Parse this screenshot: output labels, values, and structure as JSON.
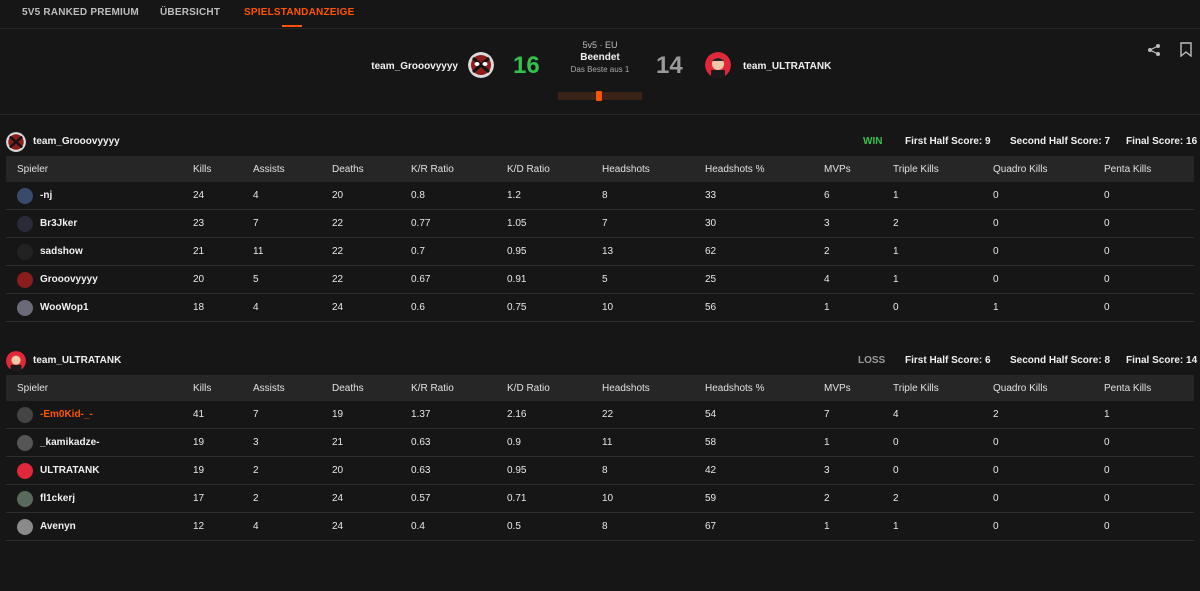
{
  "tabs": [
    {
      "label": "5V5 RANKED PREMIUM",
      "active": false
    },
    {
      "label": "ÜBERSICHT",
      "active": false
    },
    {
      "label": "SPIELSTANDANZEIGE",
      "active": true
    }
  ],
  "colors": {
    "accent": "#ff5500",
    "win": "#32c24d",
    "loss": "#9a9a9a"
  },
  "match": {
    "team1": {
      "name": "team_Grooovyyyy",
      "score": "16"
    },
    "team2": {
      "name": "team_ULTRATANK",
      "score": "14"
    },
    "region": "5v5 · EU",
    "status": "Beendet",
    "format": "Das Beste aus 1",
    "icons": [
      "share-icon",
      "bookmark-icon"
    ]
  },
  "teams": [
    {
      "name": "team_Grooovyyyy",
      "result": "WIN",
      "first_half": "First Half Score: 9",
      "second_half": "Second Half Score: 7",
      "final": "Final Score: 16",
      "columns": [
        "Spieler",
        "Kills",
        "Assists",
        "Deaths",
        "K/R Ratio",
        "K/D Ratio",
        "Headshots",
        "Headshots %",
        "MVPs",
        "Triple Kills",
        "Quadro Kills",
        "Penta Kills"
      ],
      "players": [
        {
          "name": "-nj",
          "stats": [
            "24",
            "4",
            "20",
            "0.8",
            "1.2",
            "8",
            "33",
            "6",
            "1",
            "0",
            "0"
          ]
        },
        {
          "name": "Br3Jker",
          "stats": [
            "23",
            "7",
            "22",
            "0.77",
            "1.05",
            "7",
            "30",
            "3",
            "2",
            "0",
            "0"
          ]
        },
        {
          "name": "sadshow",
          "stats": [
            "21",
            "11",
            "22",
            "0.7",
            "0.95",
            "13",
            "62",
            "2",
            "1",
            "0",
            "0"
          ]
        },
        {
          "name": "Grooovyyyy",
          "stats": [
            "20",
            "5",
            "22",
            "0.67",
            "0.91",
            "5",
            "25",
            "4",
            "1",
            "0",
            "0"
          ]
        },
        {
          "name": "WooWop1",
          "stats": [
            "18",
            "4",
            "24",
            "0.6",
            "0.75",
            "10",
            "56",
            "1",
            "0",
            "1",
            "0"
          ]
        }
      ]
    },
    {
      "name": "team_ULTRATANK",
      "result": "LOSS",
      "first_half": "First Half Score: 6",
      "second_half": "Second Half Score: 8",
      "final": "Final Score: 14",
      "columns": [
        "Spieler",
        "Kills",
        "Assists",
        "Deaths",
        "K/R Ratio",
        "K/D Ratio",
        "Headshots",
        "Headshots %",
        "MVPs",
        "Triple Kills",
        "Quadro Kills",
        "Penta Kills"
      ],
      "players": [
        {
          "name": "-Em0Kid-_-",
          "stats": [
            "41",
            "7",
            "19",
            "1.37",
            "2.16",
            "22",
            "54",
            "7",
            "4",
            "2",
            "1"
          ]
        },
        {
          "name": "_kamikadze-",
          "stats": [
            "19",
            "3",
            "21",
            "0.63",
            "0.9",
            "11",
            "58",
            "1",
            "0",
            "0",
            "0"
          ]
        },
        {
          "name": "ULTRATANK",
          "stats": [
            "19",
            "2",
            "20",
            "0.63",
            "0.95",
            "8",
            "42",
            "3",
            "0",
            "0",
            "0"
          ]
        },
        {
          "name": "fl1ckerj",
          "stats": [
            "17",
            "2",
            "24",
            "0.57",
            "0.71",
            "10",
            "59",
            "2",
            "2",
            "0",
            "0"
          ]
        },
        {
          "name": "Avenyn",
          "stats": [
            "12",
            "4",
            "24",
            "0.4",
            "0.5",
            "8",
            "67",
            "1",
            "1",
            "0",
            "0"
          ]
        }
      ]
    }
  ]
}
